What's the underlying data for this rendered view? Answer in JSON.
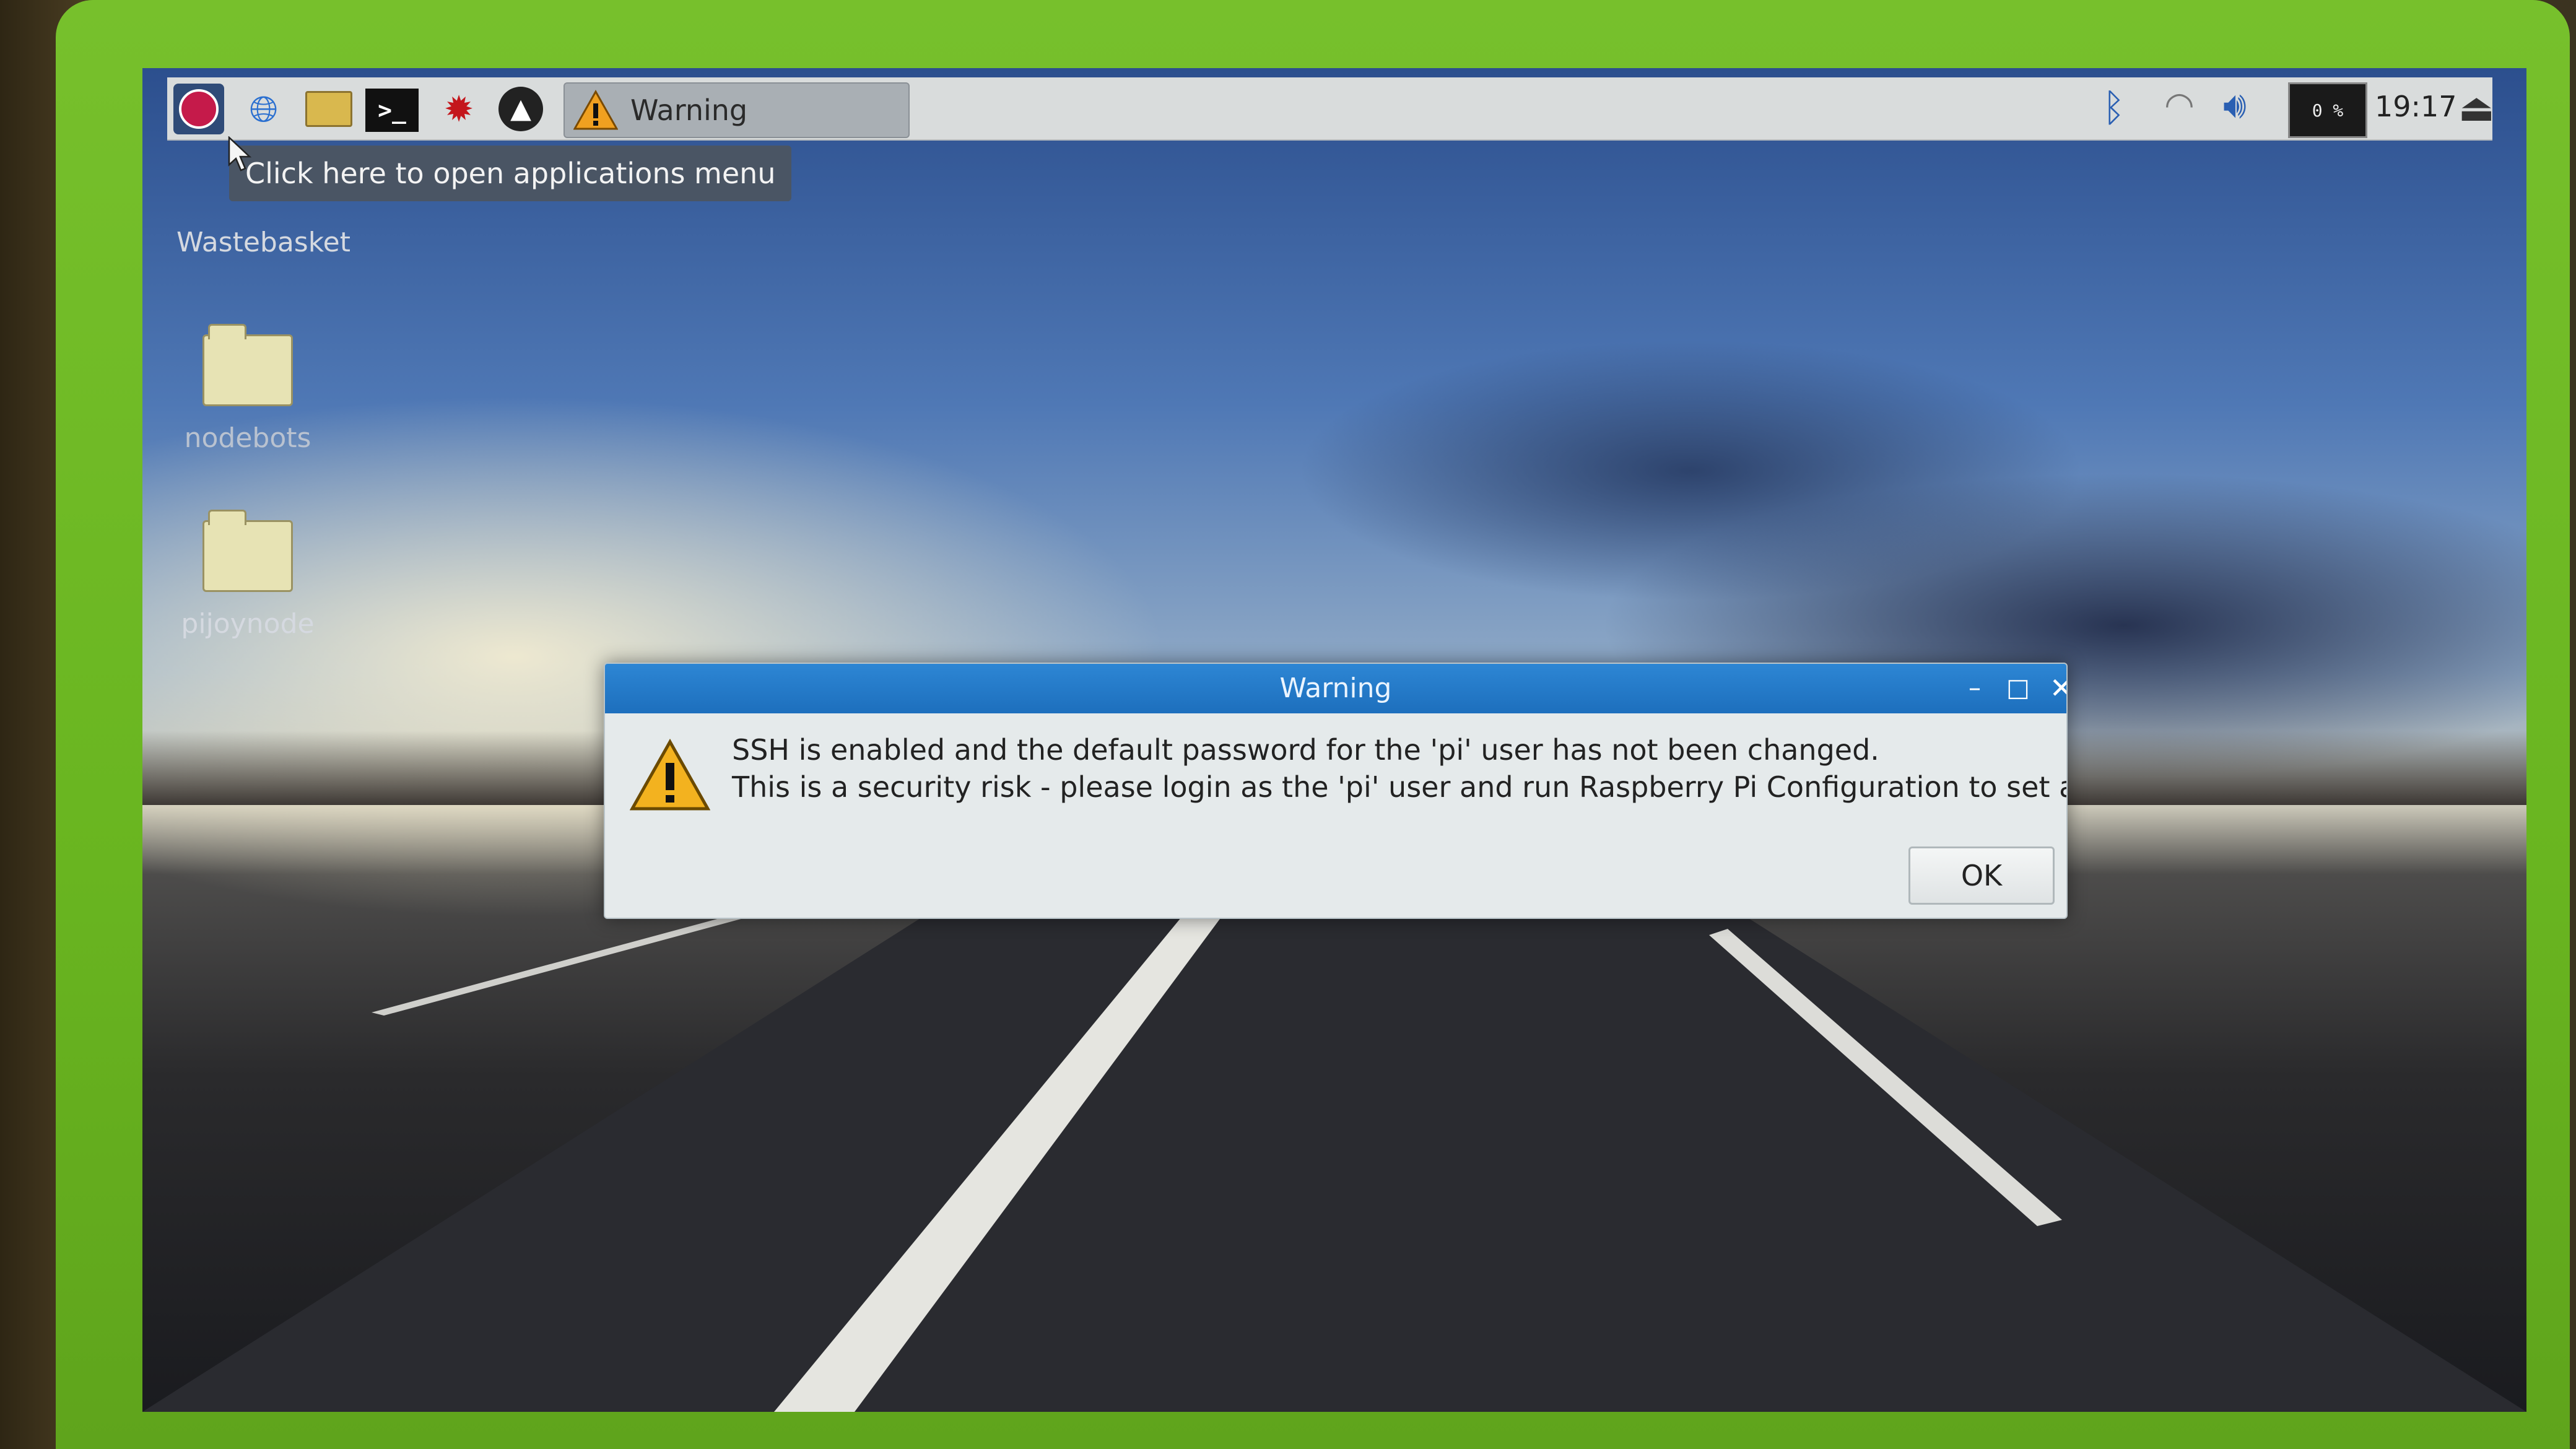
{
  "colors": {
    "bezel": "#6ab821",
    "taskbar": "#d9dcdc",
    "dialog_title_bar": "#1d6fbd",
    "dialog_body": "#e5eaeb"
  },
  "taskbar": {
    "launchers": [
      {
        "name": "raspberry-pi-menu",
        "icon": "raspberry-icon"
      },
      {
        "name": "web-browser",
        "icon": "globe-icon"
      },
      {
        "name": "file-manager",
        "icon": "folder-icon"
      },
      {
        "name": "terminal",
        "icon": "terminal-icon",
        "glyph": ">_"
      },
      {
        "name": "mathematica",
        "icon": "spiky-red-icon"
      },
      {
        "name": "wolfram",
        "icon": "wolf-icon"
      }
    ],
    "active_task_label": "Warning",
    "cpu_monitor_text": "0 %",
    "clock": "19:17"
  },
  "tooltip": {
    "text": "Click here to open applications menu"
  },
  "desktop": {
    "icons": [
      {
        "label": "Wastebasket",
        "icon": "trash-icon"
      },
      {
        "label": "nodebots",
        "icon": "folder-icon"
      },
      {
        "label": "pijoynode",
        "icon": "folder-icon"
      }
    ]
  },
  "dialog": {
    "title": "Warning",
    "message_line_1": "SSH is enabled and the default password for the 'pi' user has not been changed.",
    "message_line_2": "This is a security risk - please login as the 'pi' user and run Raspberry Pi Configuration to set a new password.",
    "ok_label": "OK"
  }
}
